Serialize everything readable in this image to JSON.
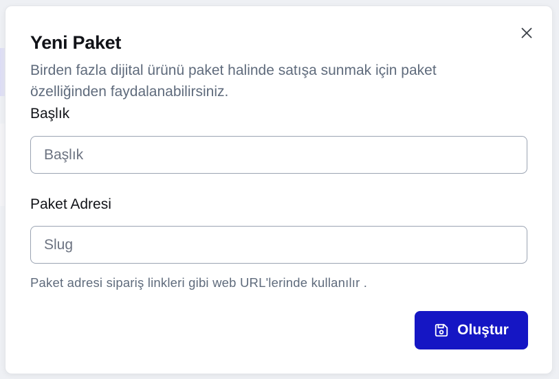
{
  "modal": {
    "title": "Yeni Paket",
    "description": "Birden fazla dijital ürünü paket halinde satışa sunmak için paket özelliğinden faydalanabilirsiniz.",
    "close_icon": "close-icon"
  },
  "form": {
    "title_field": {
      "label": "Başlık",
      "placeholder": "Başlık",
      "value": ""
    },
    "slug_field": {
      "label": "Paket Adresi",
      "placeholder": "Slug",
      "value": "",
      "helper": "Paket adresi sipariş linkleri gibi web URL'lerinde kullanılır ."
    },
    "submit": {
      "label": "Oluştur",
      "icon": "save-icon"
    }
  },
  "colors": {
    "primary": "#1516c4",
    "muted_text": "#5f6b7c",
    "heading": "#111318",
    "border": "#9aa3b2"
  }
}
